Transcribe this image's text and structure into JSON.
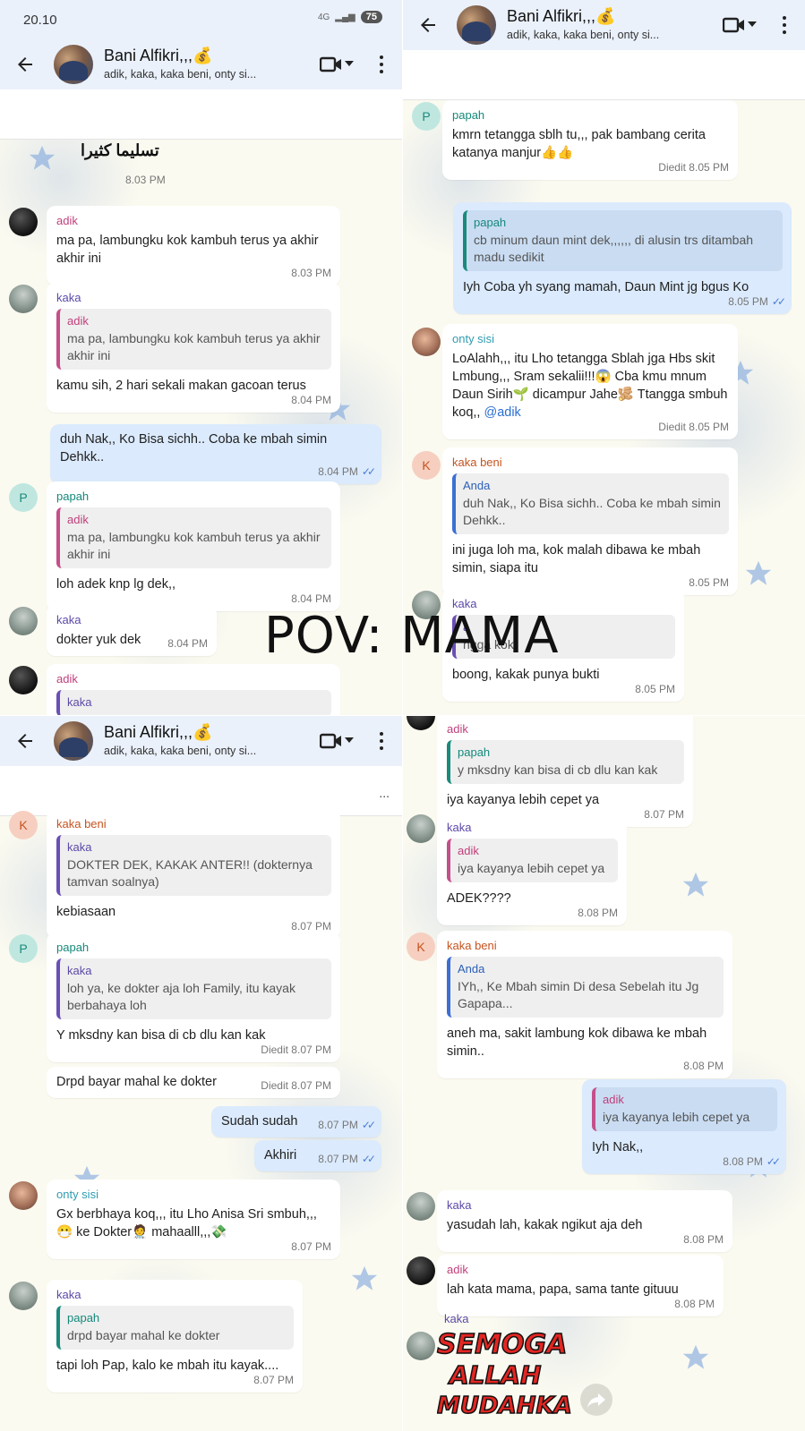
{
  "chat": {
    "title": "Bani Alfikri,,,💰",
    "members": "adik, kaka, kaka beni, onty si...",
    "pin_dots": "..."
  },
  "statusbar": {
    "time": "20.10",
    "battery": "75",
    "network": "4G"
  },
  "overlay": {
    "caption": "POV: MAMA"
  },
  "sticker": {
    "line1": "SEMOGA",
    "line2": "ALLAH",
    "line3": "MUDAHKAN"
  },
  "panels": {
    "top_left": {
      "partial_text": "تسليما كثيرا",
      "partial_time": "8.03 PM",
      "messages": [
        {
          "sender": "adik",
          "text": "ma pa, lambungku kok kambuh terus ya akhir akhir ini",
          "time": "8.03 PM"
        },
        {
          "sender": "kaka",
          "quote_name": "adik",
          "quote_text": "ma pa, lambungku kok kambuh terus ya akhir akhir ini",
          "text": "kamu sih, 2 hari sekali makan gacoan terus",
          "time": "8.04 PM"
        },
        {
          "sender": "",
          "text": "duh Nak,, Ko Bisa sichh.. Coba ke mbah simin Dehkk..",
          "time": "8.04 PM"
        },
        {
          "sender": "papah",
          "quote_name": "adik",
          "quote_text": "ma pa, lambungku kok kambuh terus ya akhir akhir ini",
          "text": "loh adek knp lg dek,,",
          "time": "8.04 PM"
        },
        {
          "sender": "kaka",
          "text": "dokter yuk dek",
          "time": "8.04 PM"
        },
        {
          "sender": "adik",
          "quote_name": "kaka",
          "text": "",
          "time": ""
        }
      ]
    },
    "top_right": {
      "messages": [
        {
          "sender": "papah",
          "text": "kmrn tetangga sblh tu,,, pak bambang cerita katanya manjur👍👍",
          "time": "Diedit 8.05 PM"
        },
        {
          "sender": "",
          "quote_name": "papah",
          "quote_text": "cb minum daun mint dek,,,,,, di alusin trs ditambah madu sedikit",
          "text": "Iyh Coba yh syang mamah, Daun Mint jg bgus Ko",
          "time": "8.05 PM"
        },
        {
          "sender": "onty sisi",
          "text": "LoAlahh,,, itu Lho tetangga Sblah jga Hbs skit Lmbung,,, Sram sekalii!!!😱 Cba kmu mnum Daun Sirih🌱 dicampur Jahe🫚 Ttangga smbuh koq,,",
          "mention": "@adik",
          "time": "Diedit 8.05 PM"
        },
        {
          "sender": "kaka beni",
          "quote_name": "Anda",
          "quote_text": "duh Nak,, Ko Bisa sichh.. Coba ke mbah simin Dehkk..",
          "text": "ini juga loh ma, kok malah dibawa ke mbah simin, siapa itu",
          "time": "8.05 PM"
        },
        {
          "sender": "kaka",
          "quote_name": "a",
          "quote_text": "ngga kok",
          "text": "boong, kakak punya bukti",
          "time": "8.05 PM"
        }
      ]
    },
    "bottom_left": {
      "messages": [
        {
          "sender": "kaka beni",
          "quote_name": "kaka",
          "quote_text": "DOKTER DEK, KAKAK ANTER!! (dokternya tamvan soalnya)",
          "text": "kebiasaan",
          "time": "8.07 PM"
        },
        {
          "sender": "papah",
          "quote_name": "kaka",
          "quote_text": "loh ya, ke dokter aja loh Family, itu kayak berbahaya loh",
          "text": "Y mksdny kan bisa di cb dlu kan kak",
          "time": "Diedit 8.07 PM"
        },
        {
          "sender": "",
          "text": "Drpd bayar mahal ke dokter",
          "time": "Diedit 8.07 PM"
        },
        {
          "sender": "",
          "text": "Sudah sudah",
          "time": "8.07 PM"
        },
        {
          "sender": "",
          "text": "Akhiri",
          "time": "8.07 PM"
        },
        {
          "sender": "onty sisi",
          "text": "Gx berbhaya koq,,, itu Lho Anisa Sri smbuh,,,😷 ke Dokter🧑‍⚕️ mahaalll,,,💸",
          "time": "8.07 PM"
        },
        {
          "sender": "kaka",
          "quote_name": "papah",
          "quote_text": "drpd bayar mahal ke dokter",
          "text": "tapi loh Pap, kalo ke mbah itu kayak....",
          "time": "8.07 PM"
        }
      ]
    },
    "bottom_right": {
      "messages": [
        {
          "sender": "adik",
          "quote_name": "papah",
          "quote_text": "y mksdny kan bisa di cb dlu kan kak",
          "text": "iya kayanya lebih cepet ya",
          "time": "8.07 PM"
        },
        {
          "sender": "kaka",
          "quote_name": "adik",
          "quote_text": "iya kayanya lebih cepet ya",
          "text": "ADEK????",
          "time": "8.08 PM"
        },
        {
          "sender": "kaka beni",
          "quote_name": "Anda",
          "quote_text": "IYh,, Ke Mbah simin Di desa Sebelah itu Jg Gapapa...",
          "text": "aneh ma, sakit lambung kok dibawa ke mbah simin..",
          "time": "8.08 PM"
        },
        {
          "sender": "",
          "quote_name": "adik",
          "quote_text": "iya kayanya lebih cepet ya",
          "text": "Iyh Nak,,",
          "time": "8.08 PM"
        },
        {
          "sender": "kaka",
          "text": "yasudah lah, kakak ngikut aja deh",
          "time": "8.08 PM"
        },
        {
          "sender": "adik",
          "text": "lah kata mama, papa, sama tante gituuu",
          "time": "8.08 PM"
        },
        {
          "sender": "kaka",
          "text": "",
          "time": ""
        }
      ]
    }
  },
  "avatars": {
    "p": "P",
    "k": "K"
  },
  "colors": {
    "header_bg": "#eaf1fb",
    "outgoing_bubble": "#dbeafc",
    "incoming_bubble": "#ffffff",
    "tick": "#4a7fd6"
  },
  "icons": [
    "back-arrow-icon",
    "video-call-icon",
    "chevron-down-icon",
    "more-vert-icon",
    "double-check-icon",
    "forward-icon",
    "star-icon"
  ]
}
